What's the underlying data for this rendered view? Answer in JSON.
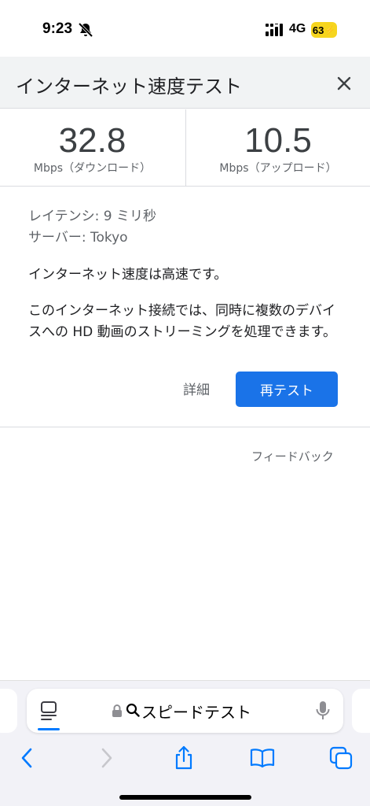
{
  "status_bar": {
    "time": "9:23",
    "network": "4G",
    "battery": "63"
  },
  "header": {
    "title": "インターネット速度テスト"
  },
  "results": {
    "download": {
      "value": "32.8",
      "unit": "Mbps（ダウンロード）"
    },
    "upload": {
      "value": "10.5",
      "unit": "Mbps（アップロード）"
    }
  },
  "details": {
    "latency": "レイテンシ: 9 ミリ秒",
    "server": "サーバー: Tokyo",
    "summary": "インターネット速度は高速です。",
    "description": "このインターネット接続では、同時に複数のデバイスへの HD 動画のストリーミングを処理できます。"
  },
  "actions": {
    "details_label": "詳細",
    "retest_label": "再テスト",
    "feedback_label": "フィードバック"
  },
  "address_bar": {
    "query": "スピードテスト"
  },
  "colors": {
    "accent": "#1a73e8",
    "safari_blue": "#007aff",
    "battery": "#f6d51f"
  }
}
